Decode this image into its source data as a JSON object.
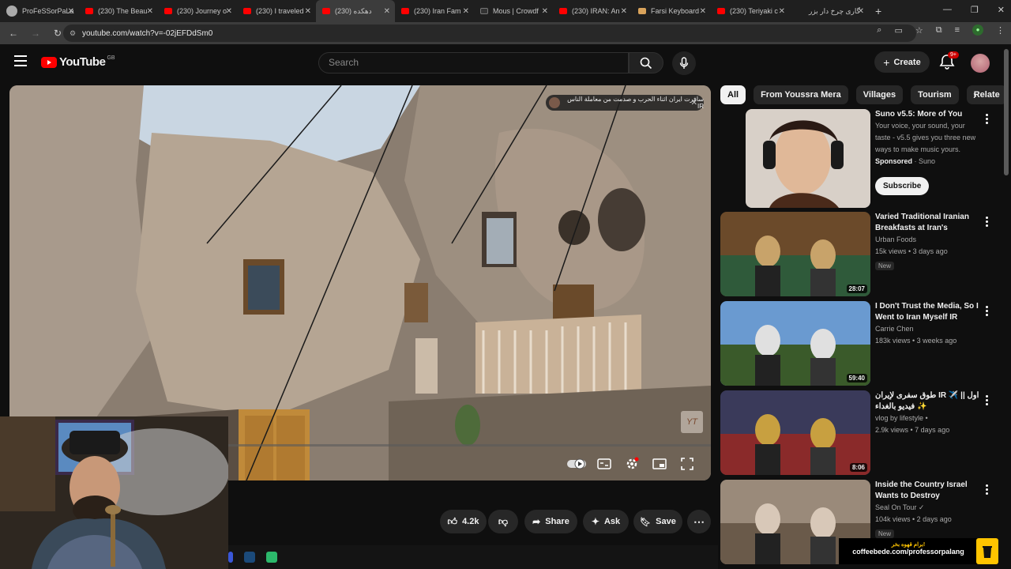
{
  "browser": {
    "tabs": [
      {
        "label": "ProFeSSorPaLa",
        "fav": "avatar"
      },
      {
        "label": "(230) The Beau",
        "fav": "yt"
      },
      {
        "label": "(230) Journey o",
        "fav": "yt"
      },
      {
        "label": "(230) I traveled",
        "fav": "yt"
      },
      {
        "label": "(230) دهکده",
        "fav": "yt"
      },
      {
        "label": "(230) Iran Fam",
        "fav": "yt"
      },
      {
        "label": "Mous | Crowdf",
        "fav": "dark"
      },
      {
        "label": "(230) IRAN: An",
        "fav": "yt"
      },
      {
        "label": "Farsi Keyboard",
        "fav": "keys"
      },
      {
        "label": "(230) Teriyaki c",
        "fav": "yt"
      },
      {
        "label": "گاری چرخ دار بزر",
        "fav": "none"
      }
    ],
    "url": "youtube.com/watch?v=-02jEFDdSm0"
  },
  "masthead": {
    "logo_text": "YouTube",
    "country": "GB",
    "search_placeholder": "Search",
    "create_label": "Create",
    "notif_count": "9+"
  },
  "player": {
    "notice_text": "سافرت ایران اثناء الحرب و صدمت من معاملة الناس IR",
    "watermark": "YT"
  },
  "actions": {
    "likes": "4.2k",
    "share": "Share",
    "ask": "Ask",
    "save": "Save"
  },
  "chips": [
    "All",
    "From Youssra Mera",
    "Villages",
    "Tourism",
    "Relate"
  ],
  "sponsored": {
    "title": "Suno v5.5: More of You",
    "desc": "Your voice, your sound, your taste - v5.5 gives you three new ways to make music yours.",
    "sponsored_label": "Sponsored",
    "advertiser": "· Suno",
    "cta": "Subscribe"
  },
  "recs": [
    {
      "title": "Varied Traditional Iranian Breakfasts at Iran's Busiest...",
      "channel": "Urban Foods",
      "stats": "15k views • 3 days ago",
      "badge": "New",
      "duration": "28:07"
    },
    {
      "title": "I Don't Trust the Media, So I Went to Iran Myself IR",
      "channel": "Carrie Chen",
      "stats": "183k views • 3 weeks ago",
      "badge": "",
      "duration": "59:40"
    },
    {
      "title": "طوق سفری لإیران IR ✈️ || اول فیدیو بالغداء ✨",
      "channel": "vlog by lifestyle •",
      "stats": "2.9k views • 7 days ago",
      "badge": "",
      "duration": "8:06"
    },
    {
      "title": "Inside the Country Israel Wants to Destroy",
      "channel": "Seal On Tour ✓",
      "stats": "104k views • 2 days ago",
      "badge": "New",
      "duration": ""
    }
  ],
  "promo": {
    "fa": "برام قهوه بخر!",
    "link": "coffeebede.com/professorpalang"
  }
}
